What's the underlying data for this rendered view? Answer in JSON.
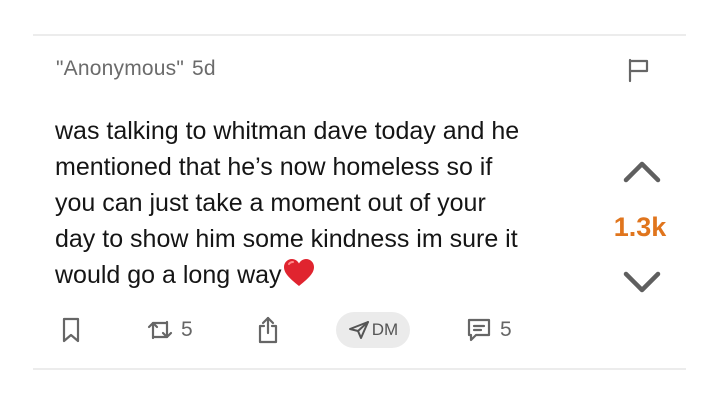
{
  "post": {
    "author": "\"Anonymous\"",
    "time": "5d",
    "lines": [
      "was talking to whitman dave today and he",
      "mentioned that he’s now homeless so if",
      "you can just take a moment out of your",
      "day to show him some kindness im sure it",
      "would go a long way"
    ],
    "score": "1.3k"
  },
  "actions": {
    "repost_count": "5",
    "dm_label": "DM",
    "comment_count": "5"
  },
  "icons": {
    "flag": "flag-icon",
    "upvote": "chevron-up-icon",
    "downvote": "chevron-down-icon",
    "bookmark": "bookmark-icon",
    "repost": "repost-icon",
    "share": "share-icon",
    "dm": "send-icon",
    "comment": "comment-icon",
    "emoji": "red-heart-icon"
  },
  "colors": {
    "score": "#e0751d",
    "heart": "#e0242f",
    "muted": "#6b6b6b"
  }
}
